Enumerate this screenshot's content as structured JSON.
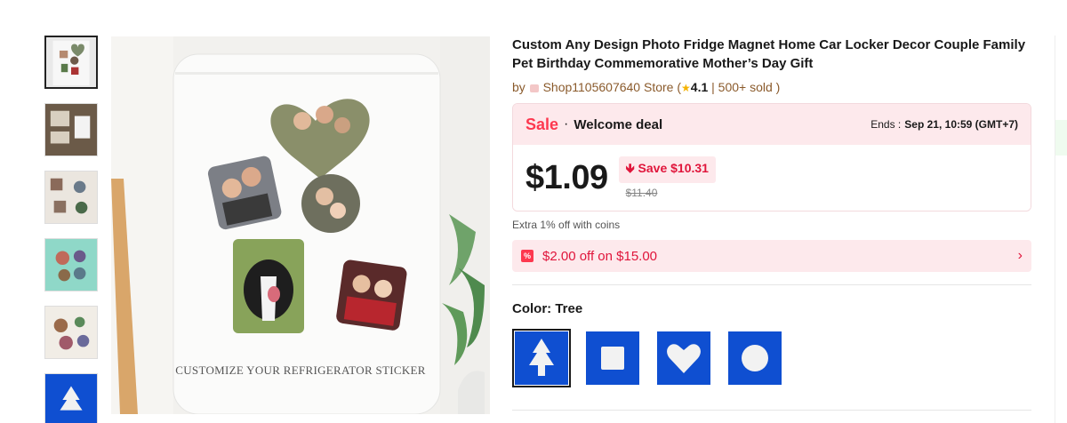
{
  "product": {
    "title": "Custom Any Design Photo Fridge Magnet Home Car Locker Decor Couple Family Pet Birthday Commemorative Mother’s Day Gift",
    "by": "by",
    "store": "Shop1105607640 Store",
    "paren_open": " (",
    "rating_star": "★",
    "rating": "4.1",
    "sold": " | 500+ sold )",
    "image_caption": "CUSTOMIZE YOUR REFRIGERATOR STICKER"
  },
  "sale": {
    "tag": "Sale",
    "dot": "·",
    "welcome": "Welcome deal",
    "ends_label": "Ends :",
    "ends_value": "Sep 21, 10:59 (GMT+7)",
    "price": "$1.09",
    "save": "🡻 Save $10.31",
    "original_price": "$11.40"
  },
  "coins_text": "Extra 1% off with coins",
  "coupon": {
    "icon_text": "%",
    "text": "$2.00 off on $15.00",
    "arrow": "›"
  },
  "color": {
    "label": "Color: Tree",
    "options": [
      "Tree",
      "Square",
      "Heart",
      "Circle"
    ],
    "selected": "Tree"
  },
  "colors": {
    "accent": "#fd384f",
    "deal_bg": "#fde9ec",
    "swatch_blue": "#0f4fd1"
  },
  "icons": [
    "tree-icon",
    "square-icon",
    "heart-icon",
    "circle-icon",
    "coupon-icon",
    "chevron-right-icon",
    "star-icon"
  ]
}
